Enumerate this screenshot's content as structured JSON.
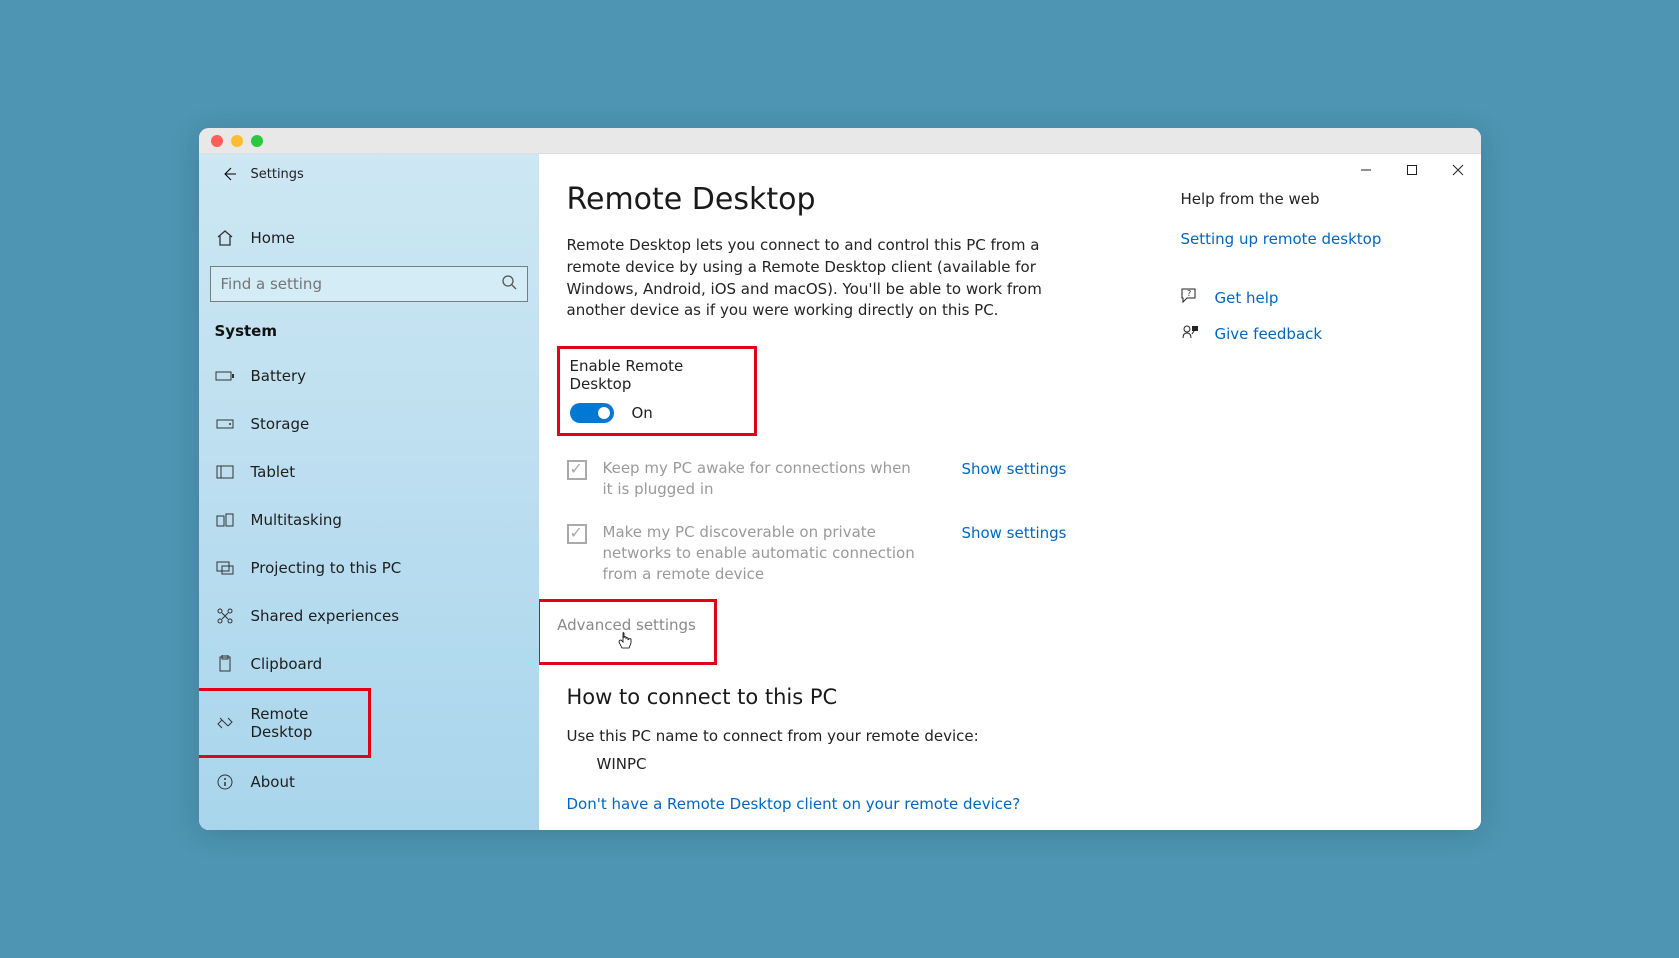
{
  "window": {
    "title": "Settings"
  },
  "sidebar": {
    "home": "Home",
    "search_placeholder": "Find a setting",
    "section": "System",
    "items": [
      {
        "id": "battery",
        "label": "Battery"
      },
      {
        "id": "storage",
        "label": "Storage"
      },
      {
        "id": "tablet",
        "label": "Tablet"
      },
      {
        "id": "multitasking",
        "label": "Multitasking"
      },
      {
        "id": "projecting",
        "label": "Projecting to this PC"
      },
      {
        "id": "shared",
        "label": "Shared experiences"
      },
      {
        "id": "clipboard",
        "label": "Clipboard"
      },
      {
        "id": "remote",
        "label": "Remote Desktop"
      },
      {
        "id": "about",
        "label": "About"
      }
    ]
  },
  "main": {
    "title": "Remote Desktop",
    "intro": "Remote Desktop lets you connect to and control this PC from a remote device by using a Remote Desktop client (available for Windows, Android, iOS and macOS). You'll be able to work from another device as if you were working directly on this PC.",
    "enable_label": "Enable Remote Desktop",
    "toggle_state": "On",
    "chk1": "Keep my PC awake for connections when it is plugged in",
    "chk2": "Make my PC discoverable on private networks to enable automatic connection from a remote device",
    "show_settings": "Show settings",
    "advanced": "Advanced settings",
    "how_title": "How to connect to this PC",
    "how_text": "Use this PC name to connect from your remote device:",
    "pcname": "WINPC",
    "no_client_link": "Don't have a Remote Desktop client on your remote device?"
  },
  "rail": {
    "title": "Help from the web",
    "link1": "Setting up remote desktop",
    "help": "Get help",
    "feedback": "Give feedback"
  }
}
